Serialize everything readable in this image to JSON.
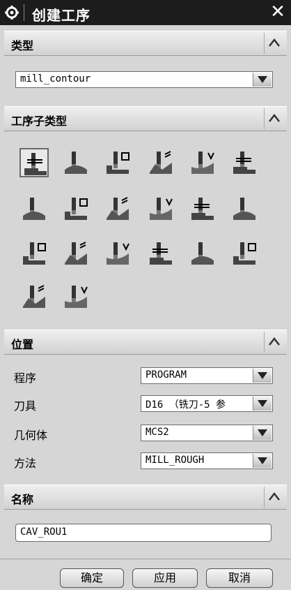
{
  "window": {
    "title": "创建工序",
    "icon": "gear-icon",
    "close_icon": "close-icon"
  },
  "type_section": {
    "label": "类型",
    "selected": "mill_contour"
  },
  "subtype_section": {
    "label": "工序子类型",
    "icons": [
      "cavity-mill-icon",
      "plunge-mill-icon",
      "corner-rough-icon",
      "rest-mill-icon",
      "zlevel-profile-icon",
      "zlevel-corner-icon",
      "fixed-contour-icon",
      "contour-area-icon",
      "contour-surface-area-icon",
      "streamline-icon",
      "contour-area-non-steep-icon",
      "contour-area-dir-steep-icon",
      "flowcut-single-icon",
      "flowcut-multiple-icon",
      "flowcut-ref-tool-icon",
      "flowcut-smooth-icon",
      "solid-profile-3d-icon",
      "contour-text-icon",
      "mill-user-icon",
      "mill-control-icon"
    ]
  },
  "location_section": {
    "label": "位置",
    "rows": [
      {
        "label": "程序",
        "value": "PROGRAM"
      },
      {
        "label": "刀具",
        "value": "D16 （铣刀-5 参"
      },
      {
        "label": "几何体",
        "value": "MCS2"
      },
      {
        "label": "方法",
        "value": "MILL_ROUGH"
      }
    ]
  },
  "name_section": {
    "label": "名称",
    "value": "CAV_ROU1"
  },
  "buttons": {
    "ok": "确定",
    "apply": "应用",
    "cancel": "取消"
  }
}
